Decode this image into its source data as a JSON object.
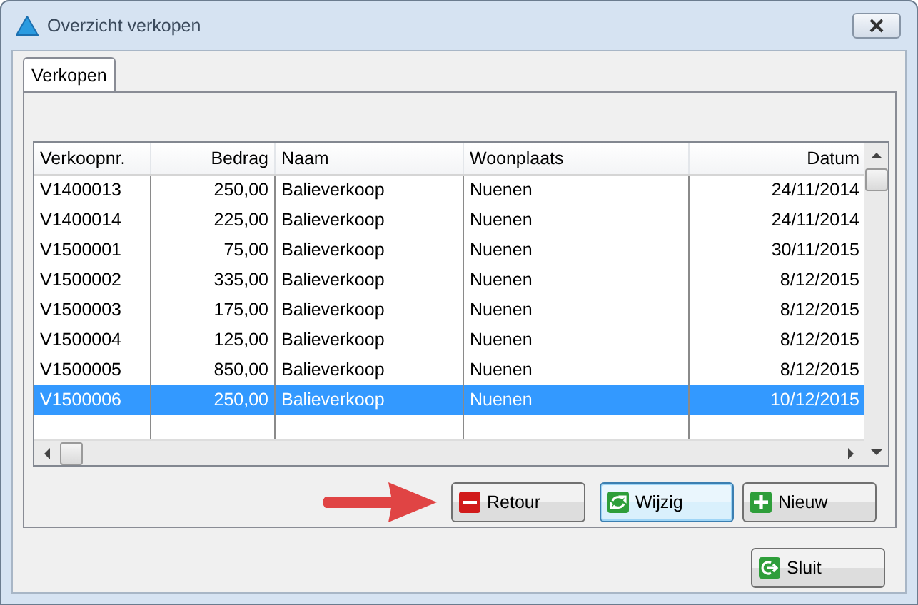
{
  "window": {
    "title": "Overzicht verkopen"
  },
  "tabs": [
    {
      "label": "Verkopen",
      "selected": true
    }
  ],
  "table": {
    "columns": [
      {
        "label": "Verkoopnr.",
        "kind": "text"
      },
      {
        "label": "Bedrag",
        "kind": "number"
      },
      {
        "label": "Naam",
        "kind": "text"
      },
      {
        "label": "Woonplaats",
        "kind": "text"
      },
      {
        "label": "Datum",
        "kind": "number"
      }
    ],
    "rows": [
      {
        "cells": [
          "V1400013",
          "250,00",
          "Balieverkoop",
          "Nuenen",
          "24/11/2014"
        ],
        "selected": false
      },
      {
        "cells": [
          "V1400014",
          "225,00",
          "Balieverkoop",
          "Nuenen",
          "24/11/2014"
        ],
        "selected": false
      },
      {
        "cells": [
          "V1500001",
          "75,00",
          "Balieverkoop",
          "Nuenen",
          "30/11/2015"
        ],
        "selected": false
      },
      {
        "cells": [
          "V1500002",
          "335,00",
          "Balieverkoop",
          "Nuenen",
          "8/12/2015"
        ],
        "selected": false
      },
      {
        "cells": [
          "V1500003",
          "175,00",
          "Balieverkoop",
          "Nuenen",
          "8/12/2015"
        ],
        "selected": false
      },
      {
        "cells": [
          "V1500004",
          "125,00",
          "Balieverkoop",
          "Nuenen",
          "8/12/2015"
        ],
        "selected": false
      },
      {
        "cells": [
          "V1500005",
          "850,00",
          "Balieverkoop",
          "Nuenen",
          "8/12/2015"
        ],
        "selected": false
      },
      {
        "cells": [
          "V1500006",
          "250,00",
          "Balieverkoop",
          "Nuenen",
          "10/12/2015"
        ],
        "selected": true
      }
    ]
  },
  "actions": [
    {
      "label": "Retour",
      "kind": "remove",
      "focused": false
    },
    {
      "label": "Wijzig",
      "kind": "refresh",
      "focused": true
    },
    {
      "label": "Nieuw",
      "kind": "add",
      "focused": false
    }
  ],
  "footer_buttons": [
    {
      "label": "Sluit",
      "kind": "exit",
      "focused": false
    }
  ]
}
